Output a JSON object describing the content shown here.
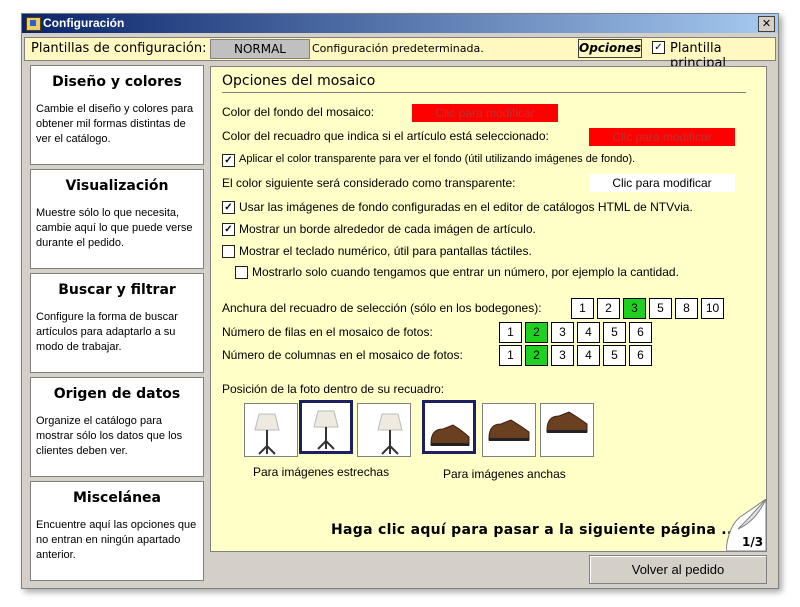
{
  "window": {
    "title": "Configuración",
    "close_label": "✕"
  },
  "toolbar": {
    "label": "Plantillas de configuración:",
    "template_name": "NORMAL",
    "template_desc": "Configuración predeterminada.",
    "options_label": "Opciones",
    "main_template_label": "Plantilla principal",
    "main_template_checked": true
  },
  "sidebar": {
    "items": [
      {
        "title": "Diseño y colores",
        "desc": "Cambie el diseño y colores para obtener mil formas distintas de ver el catálogo."
      },
      {
        "title": "Visualización",
        "desc": "Muestre sólo lo que necesita, cambie aquí lo que puede verse durante el pedido."
      },
      {
        "title": "Buscar y filtrar",
        "desc": "Configure la forma de buscar artículos para adaptarlo a su modo de trabajar."
      },
      {
        "title": "Origen de datos",
        "desc": "Organize el catálogo para mostrar sólo los datos que los clientes deben ver."
      },
      {
        "title": "Miscelánea",
        "desc": "Encuentre aquí las opciones que no entran en ningún apartado anterior."
      }
    ]
  },
  "panel": {
    "title": "Opciones del mosaico",
    "bg_color_label": "Color del fondo del mosaico:",
    "bg_color_button": "Clic para modificar",
    "sel_color_label": "Color del recuadro que indica si el artículo está seleccionado:",
    "sel_color_button": "Clic para modificar",
    "transparent_check": "Aplicar el color transparente para ver el fondo (útil utilizando imágenes de fondo).",
    "transparent_label": "El color siguiente será considerado como transparente:",
    "transparent_button": "Clic para modificar",
    "bg_images_check": "Usar las imágenes de fondo configuradas en el editor de catálogos HTML de NTVvia.",
    "border_check": "Mostrar un borde alrededor de cada imágen de artículo.",
    "keypad_check": "Mostrar el teclado numérico, útil para pantallas táctiles.",
    "keypad_sub_check": "Mostrarlo solo cuando tengamos que entrar un número, por ejemplo la cantidad.",
    "width_label": "Anchura del recuadro de selección (sólo en los bodegones):",
    "width_options": [
      "1",
      "2",
      "3",
      "5",
      "8",
      "10"
    ],
    "width_selected": "3",
    "rows_label": "Número de filas en el mosaico de fotos:",
    "rows_options": [
      "1",
      "2",
      "3",
      "4",
      "5",
      "6"
    ],
    "rows_selected": "2",
    "cols_label": "Número de columnas en el mosaico de fotos:",
    "cols_options": [
      "1",
      "2",
      "3",
      "4",
      "5",
      "6"
    ],
    "cols_selected": "2",
    "position_label": "Posición de la foto dentro de su recuadro:",
    "narrow_caption": "Para imágenes estrechas",
    "wide_caption": "Para imágenes anchas",
    "next_page": "Haga clic aquí para pasar a la siguiente página ...",
    "page_indicator": "1/3"
  },
  "footer": {
    "back_button": "Volver al pedido"
  },
  "colors": {
    "panel_bg": "#ffffc8",
    "selected_num": "#20d020",
    "red_swatch": "#ff0000",
    "title_blue": "#0a246a"
  },
  "icons": [
    "app-icon",
    "close-icon",
    "checkbox-icon",
    "lamp-image",
    "shoe-image",
    "page-curl-icon"
  ]
}
